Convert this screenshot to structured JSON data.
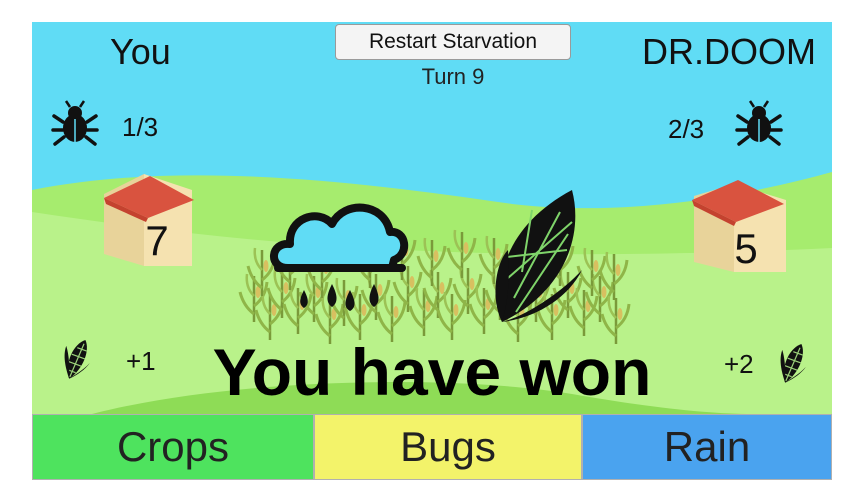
{
  "header": {
    "player_name": "You",
    "opponent_name": "DR.DOOM",
    "restart_label": "Restart Starvation",
    "turn_label": "Turn 9"
  },
  "player": {
    "bugs": "1/3",
    "house_count": "7",
    "crop_gain": "+1"
  },
  "opponent": {
    "bugs": "2/3",
    "house_count": "5",
    "crop_gain": "+2"
  },
  "result_message": "You have won",
  "actions": {
    "crops_label": "Crops",
    "bugs_label": "Bugs",
    "rain_label": "Rain"
  },
  "colors": {
    "sky": "#60dcf5",
    "grass": "#b7f08a",
    "crops_button": "#4ee35e",
    "bugs_button": "#f3f36a",
    "rain_button": "#4aa3ef"
  },
  "icons": [
    "bug-icon",
    "house-icon",
    "corn-icon",
    "rain-cloud-icon",
    "cornfield"
  ]
}
